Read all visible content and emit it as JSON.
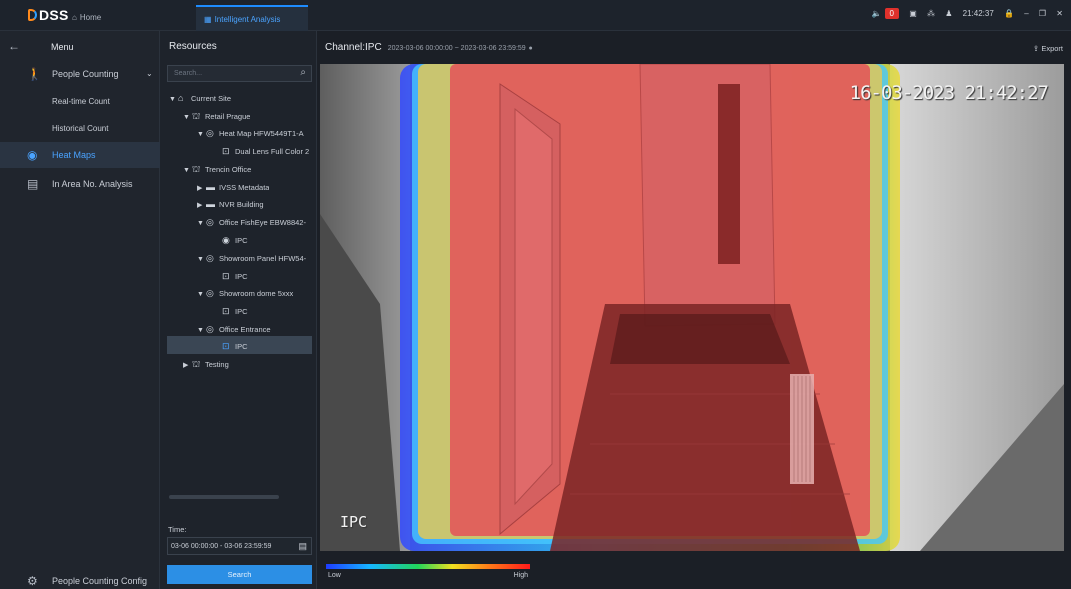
{
  "app": {
    "logo": "DSS",
    "tabs": [
      {
        "label": "Home",
        "icon": "home-icon"
      },
      {
        "label": "Intelligent Analysis",
        "icon": "grid-icon"
      }
    ],
    "status": {
      "alarm_count": "0",
      "clock": "21:42:37"
    }
  },
  "sidebar": {
    "menu_label": "Menu",
    "items": [
      {
        "label": "People Counting",
        "icon": "person-walk-icon"
      },
      {
        "label": "Real-time Count"
      },
      {
        "label": "Historical Count"
      },
      {
        "label": "Heat Maps",
        "icon": "heatmap-icon",
        "active": true
      },
      {
        "label": "In Area No. Analysis",
        "icon": "area-analysis-icon"
      }
    ],
    "config_label": "People Counting Config"
  },
  "resources": {
    "title": "Resources",
    "search_placeholder": "Search...",
    "tree": [
      {
        "label": "Current Site"
      },
      {
        "label": "Retail Prague"
      },
      {
        "label": "Heat Map HFW5449T1-A"
      },
      {
        "label": "Dual Lens Full Color 2"
      },
      {
        "label": "Trencin Office"
      },
      {
        "label": "IVSS Metadata"
      },
      {
        "label": "NVR Building"
      },
      {
        "label": "Office FishEye EBW8842-"
      },
      {
        "label": "IPC"
      },
      {
        "label": "Showroom Panel HFW54-"
      },
      {
        "label": "IPC"
      },
      {
        "label": "Showroom dome 5xxx"
      },
      {
        "label": "IPC"
      },
      {
        "label": "Office Entrance"
      },
      {
        "label": "IPC"
      },
      {
        "label": "Testing"
      }
    ],
    "time_label": "Time:",
    "time_value": "03-06 00:00:00 - 03-06 23:59:59",
    "search_button": "Search"
  },
  "main": {
    "channel_title": "Channel:IPC",
    "channel_range": "2023-03-06 00:00:00 ~ 2023-03-06 23:59:59",
    "export_label": "Export",
    "camera_timestamp": "16-03-2023 21:42:27",
    "camera_label": "IPC",
    "legend_low": "Low",
    "legend_high": "High"
  },
  "colors": {
    "accent": "#2c8fe5",
    "heat_hot": "#e04a4a",
    "alarm": "#e0312c"
  }
}
